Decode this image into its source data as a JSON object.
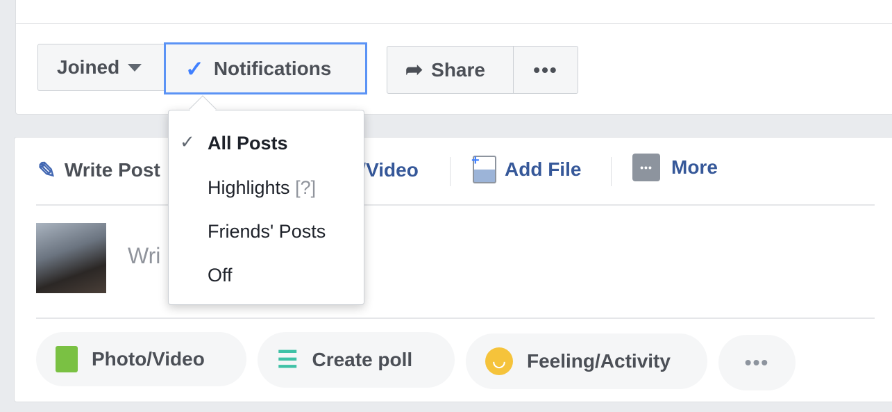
{
  "header": {
    "joined_label": "Joined",
    "notifications_label": "Notifications",
    "share_label": "Share"
  },
  "notifications_menu": {
    "items": [
      {
        "label": "All Posts",
        "checked": true
      },
      {
        "label": "Highlights",
        "hint": "[?]"
      },
      {
        "label": "Friends' Posts"
      },
      {
        "label": "Off"
      }
    ]
  },
  "composer": {
    "tabs": [
      {
        "label": "Write Post",
        "icon": "pencil-icon"
      },
      {
        "label": "Photo/Video",
        "icon": "photo-icon"
      },
      {
        "label": "Add File",
        "icon": "add-file-icon"
      },
      {
        "label": "More",
        "icon": "more-icon"
      }
    ],
    "placeholder": "Wri",
    "actions": [
      {
        "label": "Photo/Video",
        "icon": "photo-icon",
        "color": "#7ac143"
      },
      {
        "label": "Create poll",
        "icon": "list-icon",
        "color": "#3fc1a6"
      },
      {
        "label": "Feeling/Activity",
        "icon": "smiley-icon",
        "color": "#f5c33b"
      }
    ]
  },
  "colors": {
    "accent": "#4080ff",
    "link": "#365899",
    "background": "#e9ebee"
  }
}
